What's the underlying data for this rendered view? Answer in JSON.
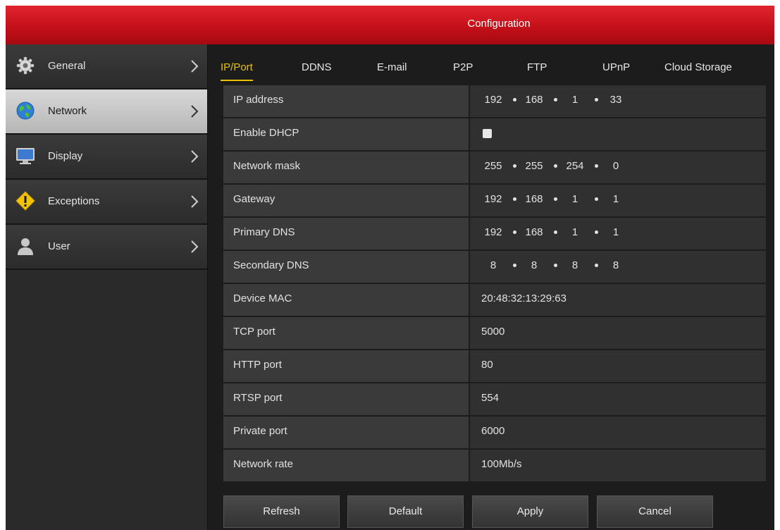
{
  "window": {
    "title": "Configuration"
  },
  "sidebar": {
    "items": [
      {
        "label": "General",
        "icon": "gear-icon"
      },
      {
        "label": "Network",
        "icon": "globe-icon",
        "active": true
      },
      {
        "label": "Display",
        "icon": "monitor-icon"
      },
      {
        "label": "Exceptions",
        "icon": "warning-icon"
      },
      {
        "label": "User",
        "icon": "user-icon"
      }
    ]
  },
  "tabs": [
    {
      "label": "IP/Port",
      "active": true
    },
    {
      "label": "DDNS"
    },
    {
      "label": "E-mail"
    },
    {
      "label": "P2P"
    },
    {
      "label": "FTP"
    },
    {
      "label": "UPnP"
    },
    {
      "label": "Cloud Storage"
    }
  ],
  "fields": {
    "ip_address": {
      "label": "IP address",
      "octets": [
        "192",
        "168",
        "1",
        "33"
      ]
    },
    "enable_dhcp": {
      "label": "Enable DHCP",
      "checked": false
    },
    "network_mask": {
      "label": "Network mask",
      "octets": [
        "255",
        "255",
        "254",
        "0"
      ]
    },
    "gateway": {
      "label": "Gateway",
      "octets": [
        "192",
        "168",
        "1",
        "1"
      ]
    },
    "primary_dns": {
      "label": "Primary DNS",
      "octets": [
        "192",
        "168",
        "1",
        "1"
      ]
    },
    "secondary_dns": {
      "label": "Secondary DNS",
      "octets": [
        "8",
        "8",
        "8",
        "8"
      ]
    },
    "device_mac": {
      "label": "Device MAC",
      "value": "20:48:32:13:29:63"
    },
    "tcp_port": {
      "label": "TCP port",
      "value": "5000"
    },
    "http_port": {
      "label": "HTTP port",
      "value": "80"
    },
    "rtsp_port": {
      "label": "RTSP port",
      "value": "554"
    },
    "private_port": {
      "label": "Private port",
      "value": "6000"
    },
    "network_rate": {
      "label": "Network rate",
      "value": "100Mb/s"
    }
  },
  "buttons": {
    "refresh": "Refresh",
    "default": "Default",
    "apply": "Apply",
    "cancel": "Cancel"
  },
  "colors": {
    "titlebar": "#c4101a",
    "active_tab": "#e8c200",
    "background": "#1c1c1c"
  }
}
